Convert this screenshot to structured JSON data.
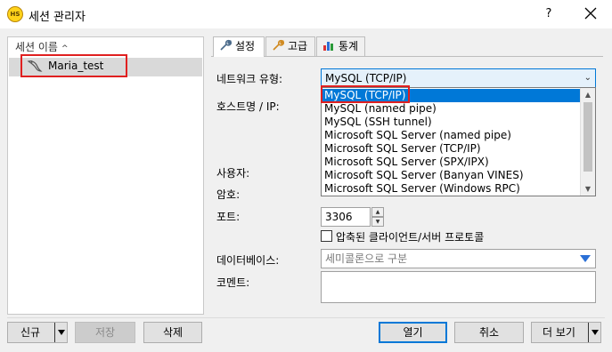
{
  "window": {
    "title": "세션 관리자",
    "help": "?",
    "app_icon_text": "HS"
  },
  "sessions": {
    "column_header": "세션 이름",
    "sort_indicator": "^",
    "items": [
      {
        "label": "Maria_test",
        "icon": "dolphin-icon"
      }
    ]
  },
  "tabs": [
    {
      "label": "설정",
      "icon": "wrench-icon",
      "active": true
    },
    {
      "label": "고급",
      "icon": "wrench-icon"
    },
    {
      "label": "통계",
      "icon": "bar-chart-icon"
    }
  ],
  "settings": {
    "network_type_label": "네트워크 유형:",
    "network_type_value": "MySQL (TCP/IP)",
    "network_type_options": [
      "MySQL (TCP/IP)",
      "MySQL (named pipe)",
      "MySQL (SSH tunnel)",
      "Microsoft SQL Server (named pipe)",
      "Microsoft SQL Server (TCP/IP)",
      "Microsoft SQL Server (SPX/IPX)",
      "Microsoft SQL Server (Banyan VINES)",
      "Microsoft SQL Server (Windows RPC)"
    ],
    "host_label": "호스트명 / IP:",
    "user_label": "사용자:",
    "password_label": "암호:",
    "port_label": "포트:",
    "port_value": "3306",
    "compress_label": "압축된 클라이언트/서버 프로토콜",
    "database_label": "데이터베이스:",
    "database_placeholder": "세미콜론으로 구분",
    "comment_label": "코멘트:"
  },
  "buttons": {
    "new": "신규",
    "save": "저장",
    "delete": "삭제",
    "open": "열기",
    "cancel": "취소",
    "more": "더 보기"
  },
  "colors": {
    "selection": "#0078d7",
    "highlight_box": "#e02020"
  }
}
